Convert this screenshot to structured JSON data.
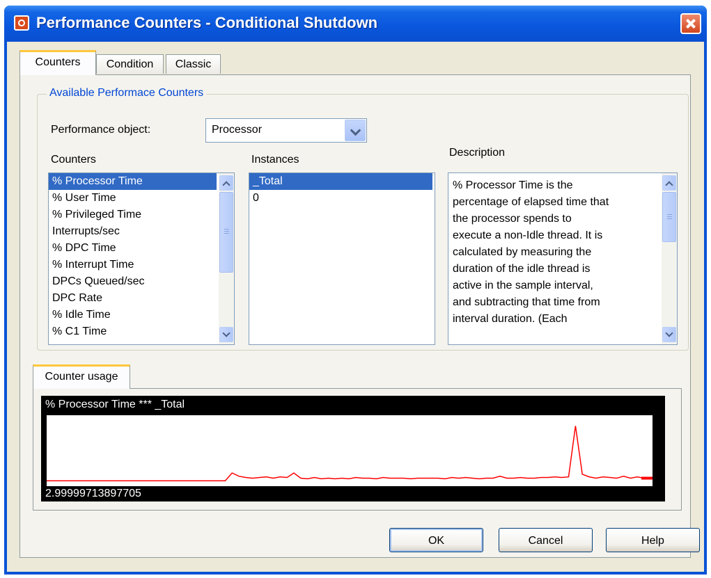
{
  "window": {
    "title": "Performance Counters - Conditional Shutdown"
  },
  "tabs": [
    {
      "label": "Counters",
      "active": true
    },
    {
      "label": "Condition",
      "active": false
    },
    {
      "label": "Classic",
      "active": false
    }
  ],
  "group": {
    "title": "Available Performace Counters"
  },
  "performance_object": {
    "label": "Performance object:",
    "value": "Processor"
  },
  "counters": {
    "label": "Counters",
    "items": [
      {
        "text": "% Processor Time",
        "selected": true
      },
      {
        "text": "% User Time",
        "selected": false
      },
      {
        "text": "% Privileged Time",
        "selected": false
      },
      {
        "text": "Interrupts/sec",
        "selected": false
      },
      {
        "text": "% DPC Time",
        "selected": false
      },
      {
        "text": "% Interrupt Time",
        "selected": false
      },
      {
        "text": "DPCs Queued/sec",
        "selected": false
      },
      {
        "text": "DPC Rate",
        "selected": false
      },
      {
        "text": "% Idle Time",
        "selected": false
      },
      {
        "text": "% C1 Time",
        "selected": false
      }
    ]
  },
  "instances": {
    "label": "Instances",
    "items": [
      {
        "text": "_Total",
        "selected": true
      },
      {
        "text": "0",
        "selected": false
      }
    ]
  },
  "description": {
    "label": "Description",
    "lines": [
      "% Processor Time is the",
      "percentage of elapsed time that",
      "the processor spends to",
      "execute a non-Idle thread. It is",
      "calculated by measuring the",
      "duration of the idle thread is",
      "active in the sample interval,",
      "and subtracting that time from",
      "interval duration.  (Each"
    ]
  },
  "usage": {
    "tab_label": "Counter usage",
    "graph_title": "% Processor Time *** _Total",
    "current_value": "2.99999713897705",
    "line_color": "#ff0000"
  },
  "chart_data": {
    "type": "line",
    "title": "% Processor Time *** _Total",
    "ylim": [
      0,
      100
    ],
    "x": [
      0,
      1,
      2,
      3,
      4,
      5,
      6,
      7,
      8,
      9,
      10,
      11,
      12,
      13,
      14,
      15,
      16,
      17,
      18,
      19,
      20,
      21,
      22,
      23,
      24,
      25,
      26,
      27,
      28,
      29,
      30,
      31,
      32,
      33,
      34,
      35,
      36,
      37,
      38,
      39,
      40,
      41,
      42,
      43,
      44,
      45,
      46,
      47,
      48,
      49,
      50,
      51,
      52,
      53,
      54,
      55,
      56,
      57,
      58,
      59,
      60,
      61,
      62,
      63,
      64,
      65,
      66,
      67,
      68,
      69,
      70,
      71,
      72,
      73,
      74,
      75,
      76,
      77,
      78,
      79,
      80,
      81,
      82,
      83,
      84,
      85,
      86,
      87
    ],
    "series": [
      {
        "values": [
          4,
          4,
          4,
          4,
          4,
          4,
          4,
          4,
          4,
          4,
          4,
          4,
          4,
          4,
          4,
          4,
          4,
          4,
          4,
          4,
          4,
          4,
          4,
          4,
          4,
          4,
          4,
          16,
          11,
          9,
          8,
          9,
          10,
          8,
          10,
          9,
          16,
          8,
          7,
          9,
          7,
          8,
          7,
          8,
          7,
          9,
          8,
          8,
          7,
          9,
          8,
          8,
          8,
          7,
          8,
          8,
          8,
          8,
          7,
          9,
          8,
          9,
          8,
          7,
          8,
          8,
          11,
          8,
          8,
          9,
          8,
          8,
          9,
          9,
          10,
          9,
          10,
          88,
          14,
          10,
          8,
          10,
          9,
          8,
          11,
          8,
          10,
          8
        ]
      }
    ]
  },
  "buttons": {
    "ok": "OK",
    "cancel": "Cancel",
    "help": "Help"
  }
}
